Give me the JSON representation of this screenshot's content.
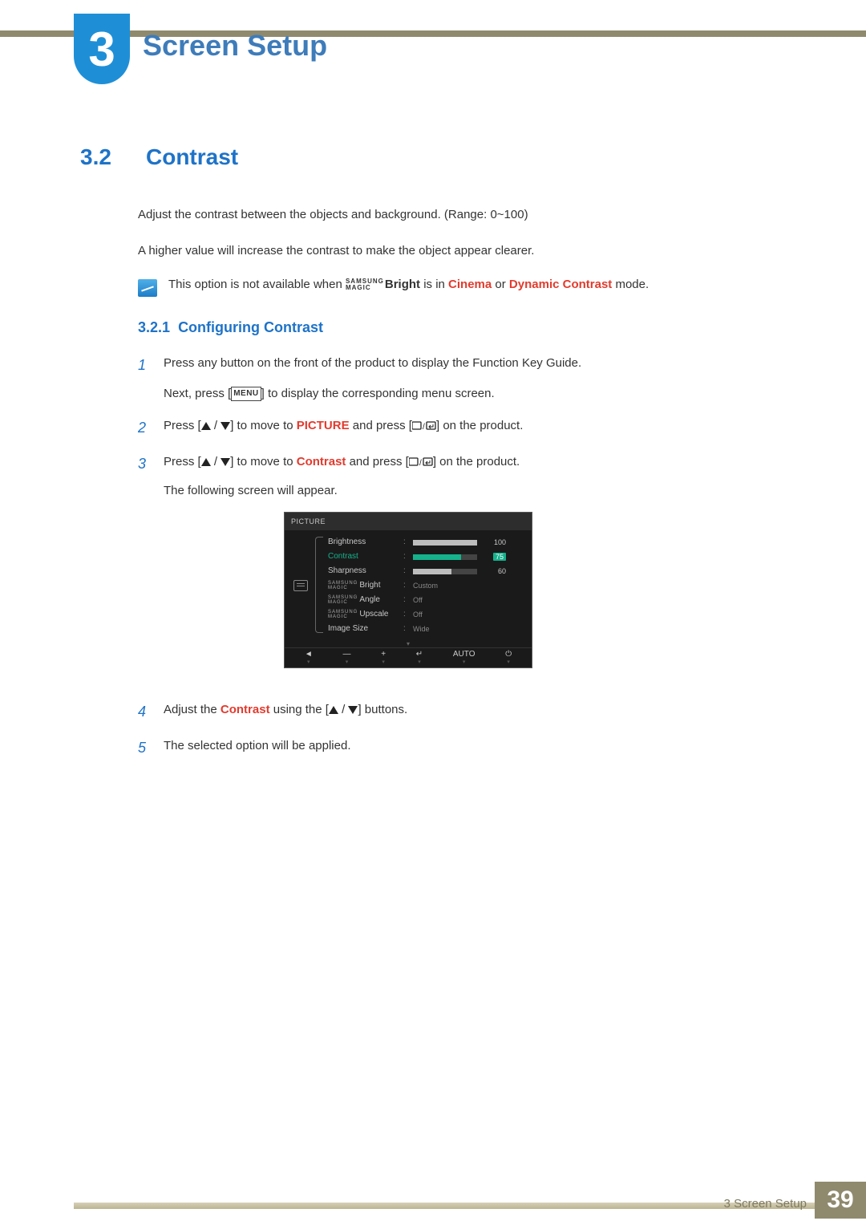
{
  "chapter": {
    "number": "3",
    "title": "Screen Setup"
  },
  "section": {
    "number": "3.2",
    "title": "Contrast"
  },
  "intro": {
    "p1": "Adjust the contrast between the objects and background. (Range: 0~100)",
    "p2": "A higher value will increase the contrast to make the object appear clearer."
  },
  "note": {
    "pre": "This option is not available when ",
    "bright": "Bright",
    "mid": " is in ",
    "cinema": "Cinema",
    "or": " or ",
    "dynamic": "Dynamic Contrast",
    "post": " mode."
  },
  "subsection": {
    "number": "3.2.1",
    "title": "Configuring Contrast"
  },
  "steps": {
    "s1a": "Press any button on the front of the product to display the Function Key Guide.",
    "s1b_pre": "Next, press [",
    "s1b_menu": "MENU",
    "s1b_post": "] to display the corresponding menu screen.",
    "s2_pre": "Press [",
    "s2_mid": "] to move to ",
    "s2_picture": "PICTURE",
    "s2_and": " and press [",
    "s2_end": "] on the product.",
    "s3_pre": "Press [",
    "s3_mid": "] to move to ",
    "s3_contrast": "Contrast",
    "s3_and": " and press [",
    "s3_end": "] on the product.",
    "s3_tail": "The following screen will appear.",
    "s4_pre": "Adjust the ",
    "s4_contrast": "Contrast",
    "s4_mid": " using the [",
    "s4_end": "] buttons.",
    "s5": "The selected option will be applied."
  },
  "osd": {
    "title": "PICTURE",
    "rows": [
      {
        "label": "Brightness",
        "value": "100",
        "bar": 100,
        "type": "bar"
      },
      {
        "label": "Contrast",
        "value": "75",
        "bar": 75,
        "type": "bar",
        "selected": true
      },
      {
        "label": "Sharpness",
        "value": "60",
        "bar": 60,
        "type": "bar"
      },
      {
        "label": "Bright",
        "value": "Custom",
        "type": "text",
        "magic": true
      },
      {
        "label": "Angle",
        "value": "Off",
        "type": "text",
        "magic": true
      },
      {
        "label": "Upscale",
        "value": "Off",
        "type": "text",
        "magic": true
      },
      {
        "label": "Image Size",
        "value": "Wide",
        "type": "text"
      }
    ],
    "footer": [
      "◄",
      "—",
      "+",
      "↵",
      "AUTO",
      "⏻"
    ]
  },
  "footer": {
    "label": "3 Screen Setup",
    "page": "39"
  }
}
